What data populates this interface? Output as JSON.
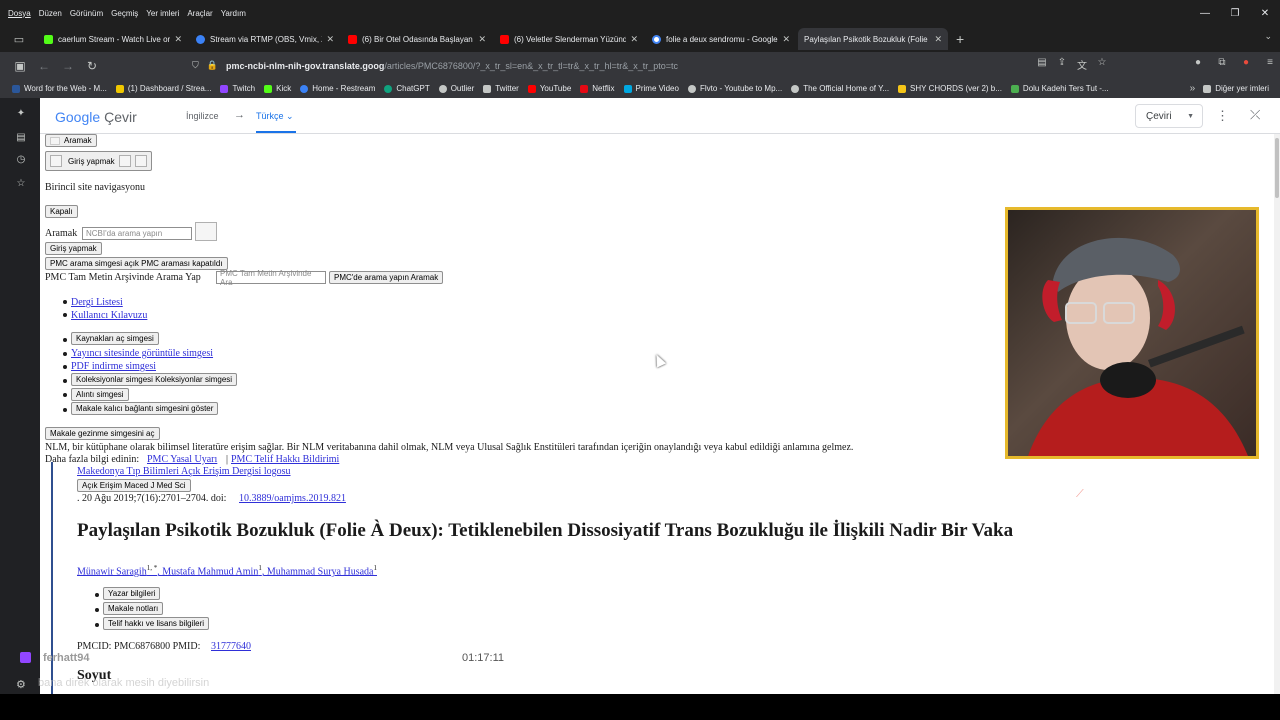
{
  "menubar": [
    "Dosya",
    "Düzen",
    "Görünüm",
    "Geçmiş",
    "Yer imleri",
    "Araçlar",
    "Yardım"
  ],
  "tabs": [
    {
      "label": "caerlum Stream - Watch Live or",
      "color": "#53fc18"
    },
    {
      "label": "Stream via RTMP (OBS, Vmix, Zo",
      "color": "#3b82f6"
    },
    {
      "label": "(6) Bir Otel Odasında Başlayan H",
      "color": "#ff0000"
    },
    {
      "label": "(6) Veletler Slenderman Yüzünde",
      "color": "#ff0000"
    },
    {
      "label": "folie a deux sendromu - Google",
      "color": "#4285f4"
    },
    {
      "label": "Paylaşılan Psikotik Bozukluk (Folie À",
      "color": "#35363a"
    }
  ],
  "address": {
    "domain": "pmc-ncbi-nlm-nih-gov.translate.goog",
    "path": "/articles/PMC6876800/?_x_tr_sl=en&_x_tr_tl=tr&_x_tr_hl=tr&_x_tr_pto=tc"
  },
  "bookmarks": [
    {
      "label": "Word for the Web - M...",
      "color": "#2b579a"
    },
    {
      "label": "(1) Dashboard / Strea...",
      "color": "#f0c800"
    },
    {
      "label": "Twitch",
      "color": "#9146ff"
    },
    {
      "label": "Kick",
      "color": "#53fc18"
    },
    {
      "label": "Home - Restream",
      "color": "#3b82f6"
    },
    {
      "label": "ChatGPT",
      "color": "#10a37f"
    },
    {
      "label": "Outlier",
      "color": "#c4c7c5"
    },
    {
      "label": "Twitter",
      "color": "#c4c7c5"
    },
    {
      "label": "YouTube",
      "color": "#ff0000"
    },
    {
      "label": "Netflix",
      "color": "#e50914"
    },
    {
      "label": "Prime Video",
      "color": "#00a8e1"
    },
    {
      "label": "Flvto - Youtube to Mp...",
      "color": "#c4c7c5"
    },
    {
      "label": "The Official Home of Y...",
      "color": "#c4c7c5"
    },
    {
      "label": "SHY CHORDS (ver 2) b...",
      "color": "#f5c518"
    },
    {
      "label": "Dolu Kadehi Ters Tut -...",
      "color": "#4caf50"
    }
  ],
  "bookmarks_other": "Diğer yer imleri",
  "translate": {
    "logo_google": "Google",
    "logo_cevir": "Çevir",
    "source_lang": "İngilizce",
    "target_lang": "Türkçe",
    "select_label": "Çeviri"
  },
  "page": {
    "btn_aramak_top": "Aramak",
    "btn_giris_top": "Giriş yapmak",
    "site_nav": "Birincil site navigasyonu",
    "btn_kapali": "Kapalı",
    "search_label": "Aramak",
    "search_placeholder": "NCBI'da arama yapın",
    "btn_giris": "Giriş yapmak",
    "btn_pmc_toggle": "PMC arama simgesi açık PMC araması kapatıldı",
    "pmc_search_label": "PMC Tam Metin Arşivinde Arama Yap",
    "pmc_search_placeholder": "PMC Tam Metin Arşivinde Ara",
    "btn_pmc_search": "PMC'de arama yapın Aramak",
    "link_dergi": "Dergi Listesi",
    "link_kilavuz": "Kullanıcı Kılavuzu",
    "btn_kaynaklar": "Kaynakları aç simgesi",
    "link_yayinci": "Yayıncı sitesinde görüntüle simgesi",
    "link_pdf": "PDF indirme simgesi",
    "btn_koleksiyon": "Koleksiyonlar simgesi Koleksiyonlar simgesi",
    "btn_alinti": "Alıntı simgesi",
    "btn_kalici": "Makale kalıcı bağlantı simgesini göster",
    "btn_gezinme": "Makale gezinme simgesini aç",
    "disclaimer": "NLM, bir kütüphane olarak bilimsel literatüre erişim sağlar. Bir NLM veritabanına dahil olmak, NLM veya Ulusal Sağlık Enstitüleri tarafından içeriğin onaylandığı veya kabul edildiği anlamına gelmez.",
    "more_info": "Daha fazla bilgi edinin:",
    "link_yasal": "PMC Yasal Uyarı",
    "sep": "|",
    "link_telif": "PMC Telif Hakkı Bildirimi",
    "link_logo": "Makedonya Tıp Bilimleri Açık Erişim Dergisi logosu",
    "btn_journal": "Açık Erişim Maced J Med Sci",
    "date_doi": ". 20 Ağu 2019;7(16):2701–2704. doi:",
    "link_doi": "10.3889/oamjms.2019.821",
    "title": "Paylaşılan Psikotik Bozukluk (Folie À Deux): Tetiklenebilen Dissosiyatif Trans Bozukluğu ile İlişkili Nadir Bir Vaka",
    "author1": "Münawir Saragih",
    "author1_sup": "1, *",
    "author2": ", Mustafa Mahmud Amin",
    "author2_sup": "1",
    "author3": ", Muhammad Surya Husada",
    "author3_sup": "1",
    "btn_yazar": "Yazar bilgileri",
    "btn_notlar": "Makale notları",
    "btn_telif": "Telif hakkı ve lisans bilgileri",
    "pmcid": "PMCID: PMC6876800 PMID:",
    "link_pmid": "31777640",
    "soyut": "Soyut"
  },
  "overlay": {
    "chat_user": "ferhatt94",
    "chat_msg": "bana direk olarak mesih diyebilirsin",
    "timer": "01:17:11"
  }
}
